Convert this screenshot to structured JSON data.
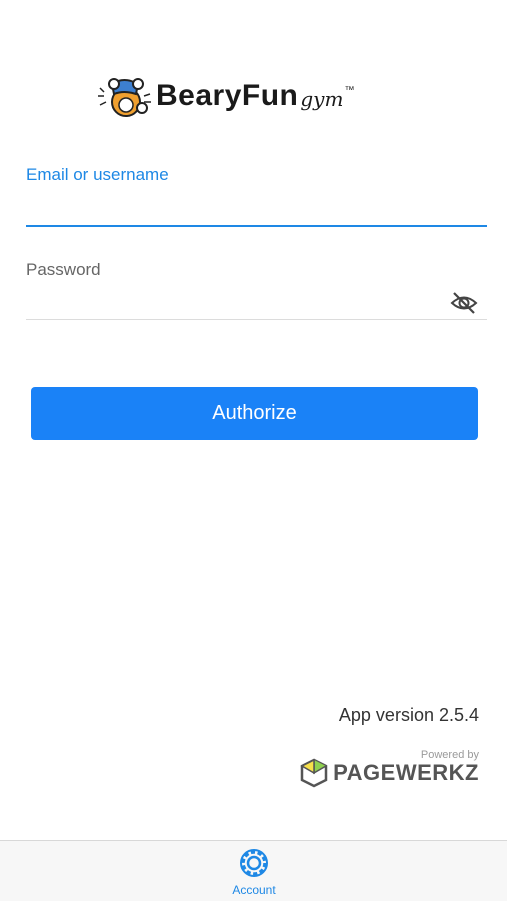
{
  "logo": {
    "main": "BearyFun",
    "sub": "gym",
    "tm": "™",
    "mascot_icon": "bear-mascot-icon"
  },
  "form": {
    "email_label": "Email or username",
    "email_value": "",
    "password_label": "Password",
    "password_value": "",
    "password_toggle_icon": "eye-slash-icon"
  },
  "authorize_button": {
    "label": "Authorize"
  },
  "footer": {
    "version": "App version 2.5.4",
    "powered_by": "Powered by",
    "brand": "PAGEWERKZ"
  },
  "tabbar": {
    "items": [
      {
        "label": "Account",
        "icon": "gear-icon",
        "active": true
      }
    ]
  },
  "colors": {
    "accent": "#1e88e5",
    "button": "#1a82f7",
    "bear_orange": "#f0a030",
    "bear_blue": "#3d7fd0"
  }
}
